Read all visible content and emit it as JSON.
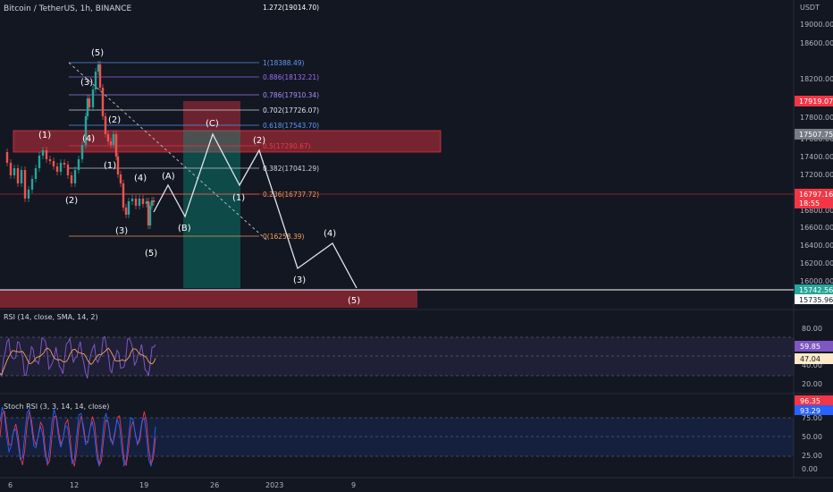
{
  "header": {
    "symbol_line": "Bitcoin / TetherUS, 1h, BINANCE",
    "currency": "USDT"
  },
  "price_axis": {
    "labels": [
      "19000.00",
      "18600.00",
      "18200.00",
      "17800.00",
      "17600.00",
      "17400.00",
      "17200.00",
      "17000.00",
      "16800.00",
      "16600.00",
      "16400.00",
      "16200.00",
      "16000.00",
      "15800.00"
    ],
    "badges": {
      "target": "17919.07",
      "box_top": "17507.75",
      "last_price": "16797.16",
      "countdown": "18:55",
      "low_green": "15742.56",
      "low_white": "15735.96"
    }
  },
  "fib_levels": [
    {
      "label": "1.272(19014.70)",
      "color": "#ffffff"
    },
    {
      "label": "1(18388.49)",
      "color": "#5b9cf6"
    },
    {
      "label": "0.886(18132.21)",
      "color": "#9c6ef1"
    },
    {
      "label": "0.786(17910.34)",
      "color": "#a78bfa"
    },
    {
      "label": "0.702(17726.07)",
      "color": "#e0e3eb"
    },
    {
      "label": "0.618(17543.70)",
      "color": "#5b9cf6"
    },
    {
      "label": "0.5(17290.67)",
      "color": "#f23645"
    },
    {
      "label": "0.382(17041.29)",
      "color": "#d1d4dc"
    },
    {
      "label": "0.236(16737.72)",
      "color": "#f7a35c"
    },
    {
      "label": "0(16258.39)",
      "color": "#f7a35c"
    }
  ],
  "wave_labels": {
    "w5_top": "(5)",
    "w3": "(3)",
    "w4": "(4)",
    "w2": "(2)",
    "w1": "(1)",
    "w1b": "(1)",
    "w2b": "(2)",
    "w3b": "(3)",
    "w4b": "(4)",
    "w5b": "(5)",
    "wA": "(A)",
    "wB": "(B)",
    "wC": "(C)",
    "p2": "(2)",
    "p1": "(1)",
    "p3": "(3)",
    "p4": "(4)",
    "p5": "(5)",
    "w1left": "(1)",
    "w4left": "(4)",
    "w2left": "(2)"
  },
  "rsi": {
    "title": "RSI (14, close, SMA, 14, 2)",
    "axis": [
      "80.00",
      "60.00",
      "40.00",
      "20.00"
    ],
    "value1": "59.85",
    "value2": "47.04"
  },
  "stoch": {
    "title": "Stoch RSI (3, 3, 14, 14, close)",
    "axis": [
      "75.00",
      "50.00",
      "25.00",
      "0.00"
    ],
    "value1": "96.35",
    "value2": "93.29"
  },
  "time_axis": [
    "6",
    "12",
    "19",
    "26",
    "2023",
    "9"
  ],
  "colors": {
    "bg": "#131722",
    "up": "#26a69a",
    "down": "#ef5350",
    "rsi_line": "#7e57c2",
    "rsi_ma": "#f7a35c",
    "stoch_k": "#2962ff",
    "stoch_d": "#f23645"
  }
}
